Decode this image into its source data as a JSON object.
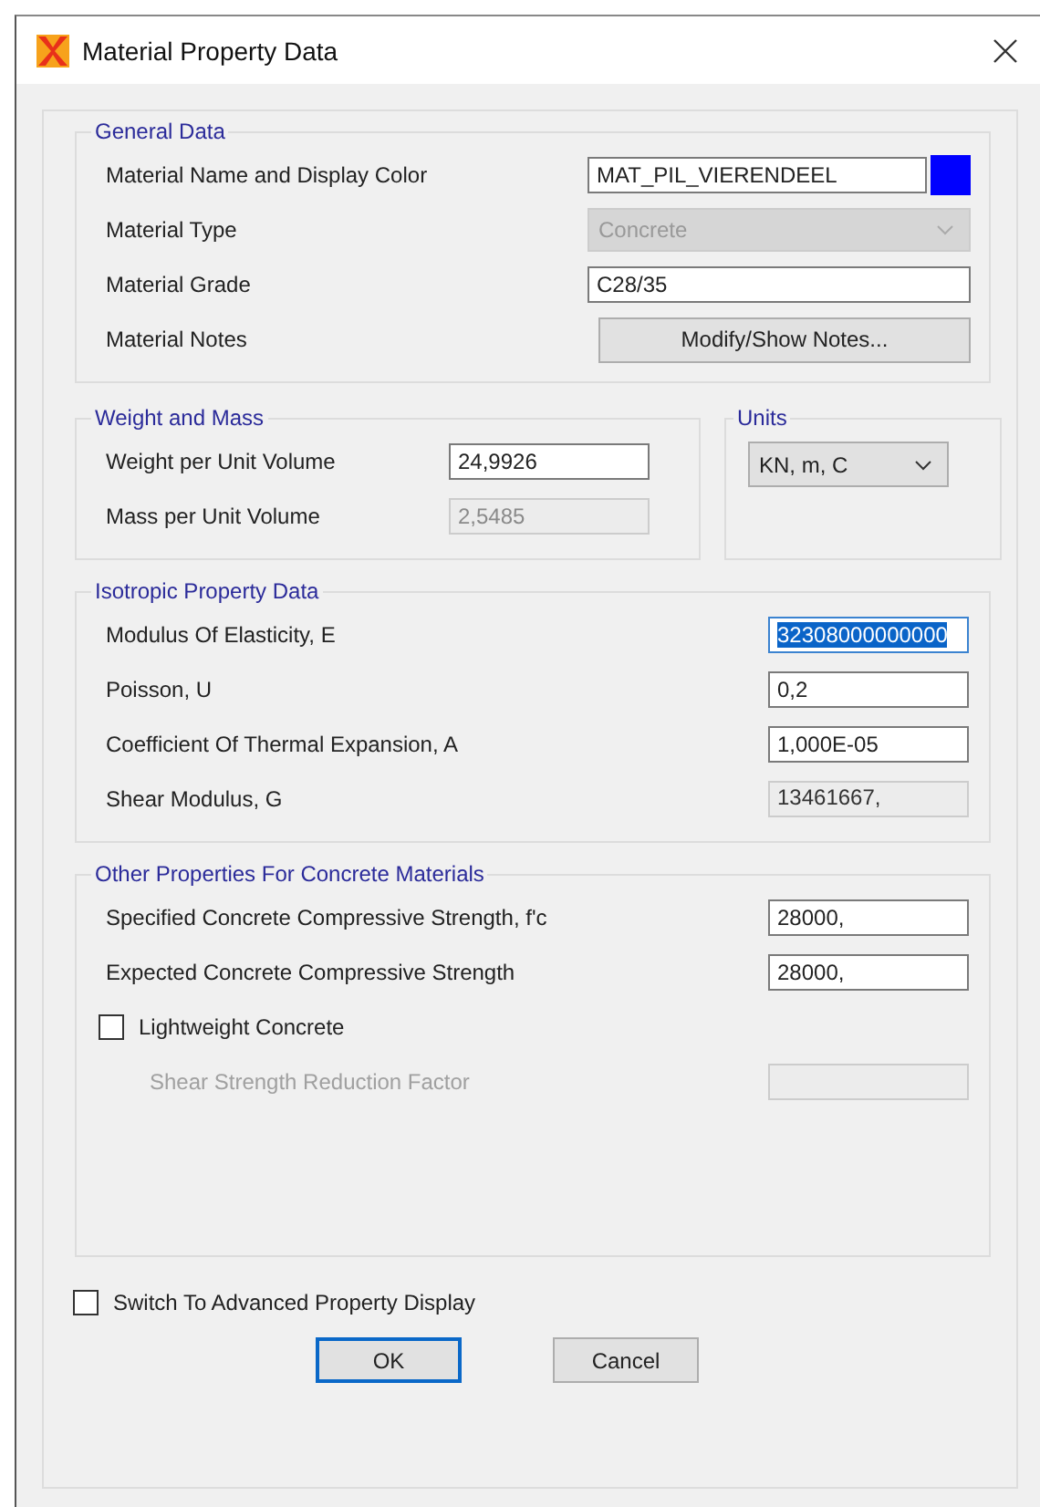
{
  "window": {
    "title": "Material Property Data"
  },
  "general": {
    "title": "General Data",
    "rows": [
      {
        "kind": "text",
        "label": "Material Name and Display Color",
        "value": "MAT_PIL_VIERENDEEL",
        "color": "#0000ff",
        "disabled": false
      },
      {
        "kind": "dropdown",
        "label": "Material Type",
        "value": "Concrete",
        "disabled": true
      },
      {
        "kind": "text",
        "label": "Material Grade",
        "value": "C28/35",
        "disabled": false
      },
      {
        "kind": "button",
        "label": "Material Notes",
        "value": "Modify/Show Notes...",
        "disabled": false
      }
    ]
  },
  "weight": {
    "title": "Weight and Mass",
    "rows": [
      {
        "kind": "text",
        "label": "Weight per Unit Volume",
        "value": "24,9926",
        "disabled": false
      },
      {
        "kind": "text",
        "label": "Mass per Unit Volume",
        "value": "2,5485",
        "disabled": true
      }
    ]
  },
  "units": {
    "title": "Units",
    "value": "KN, m, C"
  },
  "isotropic": {
    "title": "Isotropic Property Data",
    "rows": [
      {
        "kind": "text",
        "label": "Modulus Of Elasticity,  E",
        "value": "32308000000000",
        "disabled": false,
        "selected": true
      },
      {
        "kind": "text",
        "label": "Poisson, U",
        "value": "0,2",
        "disabled": false,
        "selected": false
      },
      {
        "kind": "text",
        "label": "Coefficient Of Thermal Expansion,  A",
        "value": "1,000E-05",
        "disabled": false,
        "selected": false
      },
      {
        "kind": "readonly",
        "label": "Shear Modulus,  G",
        "value": "13461667,",
        "disabled": true,
        "selected": false
      }
    ]
  },
  "concrete": {
    "title": "Other Properties For Concrete Materials",
    "rows": [
      {
        "kind": "text",
        "label": "Specified Concrete Compressive Strength, f'c",
        "value": "28000,",
        "disabled": false
      },
      {
        "kind": "text",
        "label": "Expected Concrete Compressive Strength",
        "value": "28000,",
        "disabled": false
      },
      {
        "kind": "checkbox",
        "label": "Lightweight Concrete",
        "checked": false
      },
      {
        "kind": "empty",
        "label": "Shear Strength Reduction Factor",
        "disabled": true
      }
    ]
  },
  "advanced": {
    "label": "Switch To Advanced Property Display",
    "checked": false
  },
  "buttons": [
    {
      "label": "OK",
      "default": true
    },
    {
      "label": "Cancel",
      "default": false
    }
  ]
}
